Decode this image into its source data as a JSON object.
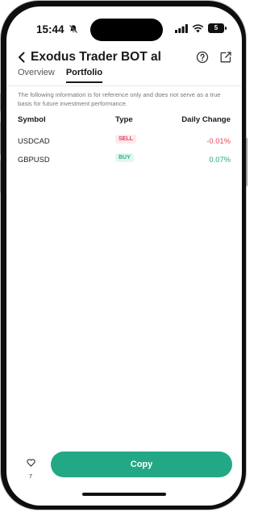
{
  "status_bar": {
    "time": "15:44",
    "battery": "5"
  },
  "header": {
    "title": "Exodus Trader BOT al"
  },
  "tabs": [
    {
      "label": "Overview",
      "active": false
    },
    {
      "label": "Portfolio",
      "active": true
    }
  ],
  "notice": "The following information is for reference only and does not serve as a true basis for future investment performance.",
  "table": {
    "columns": {
      "symbol": "Symbol",
      "type": "Type",
      "change": "Daily Change"
    },
    "rows": [
      {
        "symbol": "USDCAD",
        "type": "SELL",
        "change": "-0.01%"
      },
      {
        "symbol": "GBPUSD",
        "type": "BUY",
        "change": "0.07%"
      }
    ]
  },
  "footer": {
    "likes": "7",
    "copy_label": "Copy"
  },
  "colors": {
    "accent": "#23a886",
    "sell": "#e0455f",
    "buy": "#27b28c"
  }
}
